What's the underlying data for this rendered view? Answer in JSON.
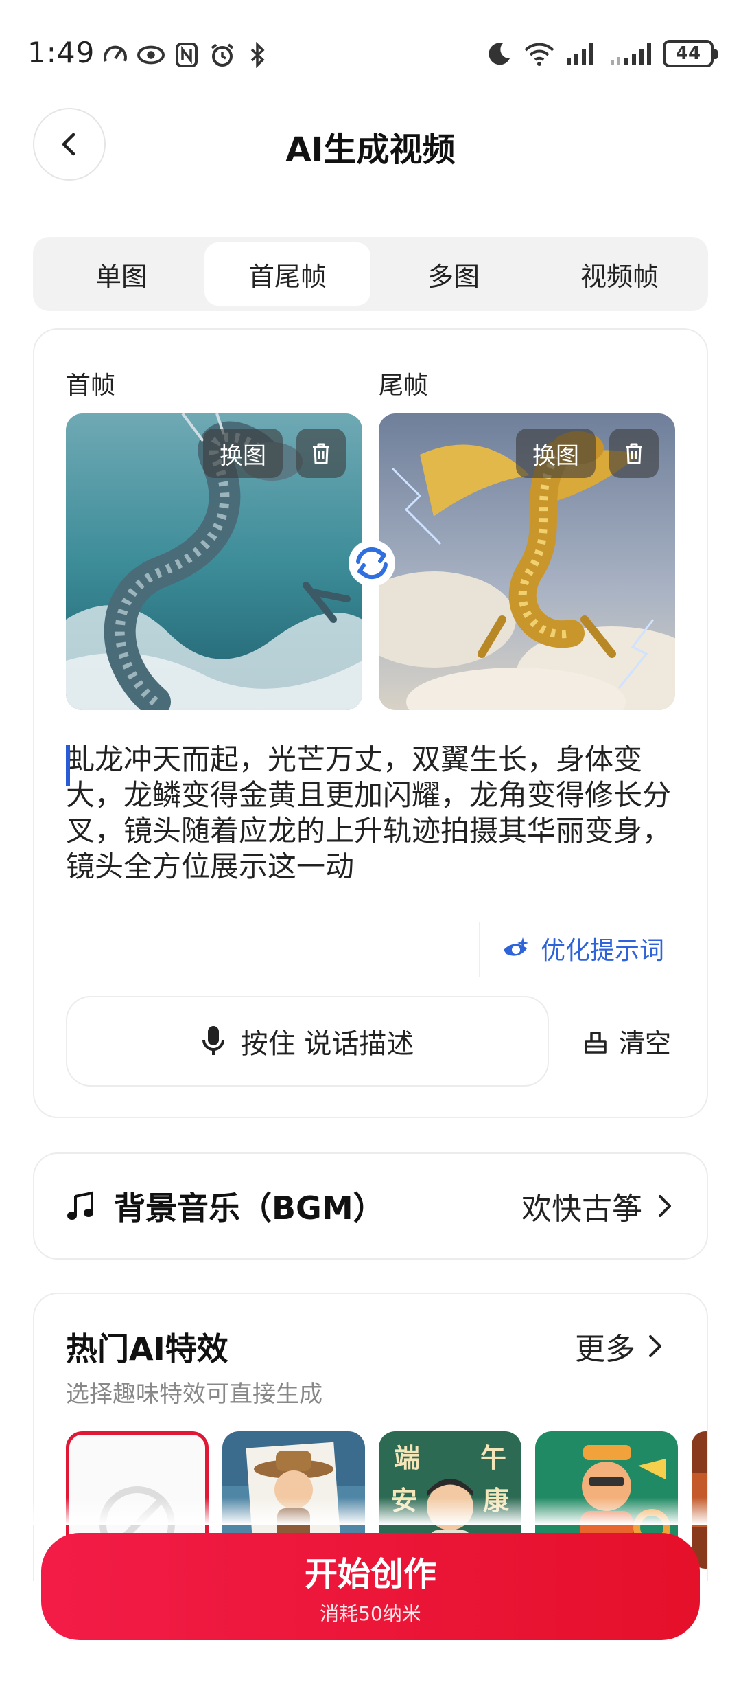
{
  "status_bar": {
    "time": "1:49",
    "battery": "44"
  },
  "header": {
    "title": "AI生成视频"
  },
  "tabs": [
    {
      "label": "单图",
      "active": false
    },
    {
      "label": "首尾帧",
      "active": true
    },
    {
      "label": "多图",
      "active": false
    },
    {
      "label": "视频帧",
      "active": false
    }
  ],
  "frames": {
    "first_label": "首帧",
    "last_label": "尾帧",
    "replace_label": "换图"
  },
  "prompt": {
    "text": "虬龙冲天而起，光芒万丈，双翼生长，身体变大，龙鳞变得金黄且更加闪耀，龙角变得修长分叉，镜头随着应龙的上升轨迹拍摄其华丽变身，镜头全方位展示这一动"
  },
  "actions": {
    "optimize_label": "优化提示词",
    "voice_label": "按住 说话描述",
    "clear_label": "清空"
  },
  "bgm": {
    "title": "背景音乐（BGM）",
    "value": "欢快古筝"
  },
  "effects": {
    "title": "热门AI特效",
    "more_label": "更多",
    "subtitle": "选择趣味特效可直接生成",
    "thumb_texts": [
      "端",
      "午",
      "安",
      "康"
    ]
  },
  "start": {
    "label": "开始创作",
    "cost": "消耗50纳米"
  },
  "colors": {
    "accent_red": "#e5102a",
    "link_blue": "#2f63d9"
  }
}
